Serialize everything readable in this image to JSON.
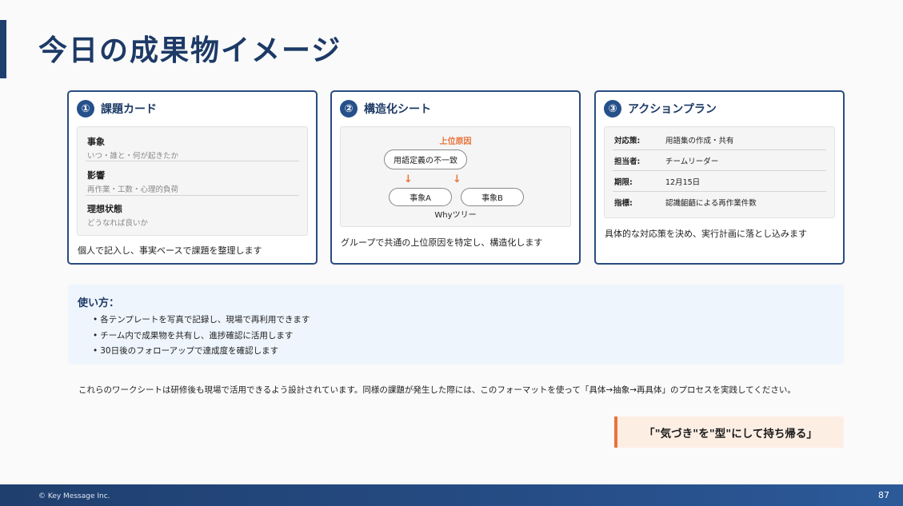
{
  "title": "今日の成果物イメージ",
  "cards": [
    {
      "number": "①",
      "title": "課題カード",
      "items": [
        {
          "title": "事象",
          "sub": "いつ・誰と・何が起きたか"
        },
        {
          "title": "影響",
          "sub": "再作業・工数・心理的負荷"
        },
        {
          "title": "理想状態",
          "sub": "どうなれば良いか"
        }
      ],
      "desc": "個人で記入し、事実ベースで課題を整理します"
    },
    {
      "number": "②",
      "title": "構造化シート",
      "diagram": {
        "top_label": "上位原因",
        "root": "用語定義の不一致",
        "arrow": "↓",
        "child_a": "事象A",
        "child_b": "事象B",
        "bottom_label": "Whyツリー"
      },
      "desc": "グループで共通の上位原因を特定し、構造化します"
    },
    {
      "number": "③",
      "title": "アクションプラン",
      "rows": [
        {
          "label": "対応策:",
          "value": "用語集の作成・共有"
        },
        {
          "label": "担当者:",
          "value": "チームリーダー"
        },
        {
          "label": "期限:",
          "value": "12月15日"
        },
        {
          "label": "指標:",
          "value": "認識齟齬による再作業件数"
        }
      ],
      "desc": "具体的な対応策を決め、実行計画に落とし込みます"
    }
  ],
  "usage": {
    "title": "使い方：",
    "bullet": "•",
    "items": [
      "各テンプレートを写真で記録し、現場で再利用できます",
      "チーム内で成果物を共有し、進捗確認に活用します",
      "30日後のフォローアップで達成度を確認します"
    ]
  },
  "note": "これらのワークシートは研修後も現場で活用できるよう設計されています。同様の課題が発生した際には、このフォーマットを使って「具体→抽象→再具体」のプロセスを実践してください。",
  "callout": "「\"気づき\"を\"型\"にして持ち帰る」",
  "footer": {
    "copyright": "© Key Message Inc.",
    "page_number": "87"
  },
  "colors": {
    "navy": "#1d3a66",
    "card_border": "#2a4c7f",
    "accent_orange": "#e8743b",
    "usage_bg": "#eef5fd",
    "callout_bg": "#fdeee4"
  }
}
